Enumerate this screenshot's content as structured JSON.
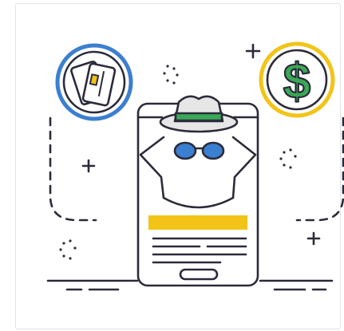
{
  "illustration": {
    "subject": "spy-on-phone-with-credit-cards-and-dollar-coin",
    "colors": {
      "outline": "#2b2b3a",
      "card_ring": "#3b7fd0",
      "coin_ring": "#f2c418",
      "dollar": "#3aa856",
      "hat_band": "#3aa856",
      "hat": "#e6e6e6",
      "lens": "#3b7fd0",
      "screen_bar": "#f2c418",
      "card_chip": "#f2c418"
    },
    "icons": [
      "credit-cards-icon",
      "dollar-coin-icon",
      "spy-icon",
      "smartphone-icon",
      "sparkle-icon",
      "plus-icon"
    ]
  }
}
